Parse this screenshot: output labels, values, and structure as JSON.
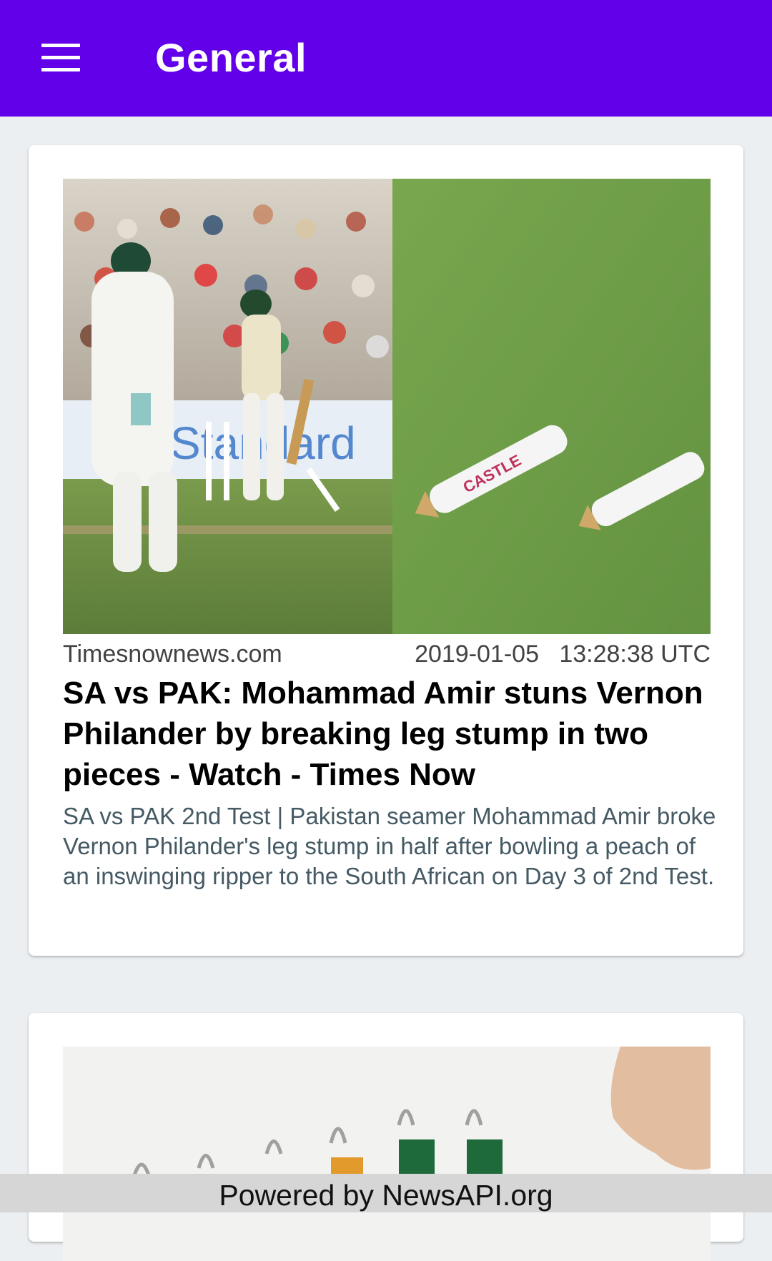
{
  "appbar": {
    "title": "General",
    "menu_icon": "menu-icon"
  },
  "articles": [
    {
      "source": "Timesnownews.com",
      "date": "2019-01-05",
      "time": "13:28:38 UTC",
      "title": "SA vs PAK: Mohammad Amir stuns Vernon Philander by breaking leg stump in two pieces - Watch - Times Now",
      "description": "SA vs PAK 2nd Test | Pakistan seamer Mohammad Amir broke Vernon Philander's leg stump in half after bowling a peach of an inswinging ripper to the South African on Day 3 of 2nd Test.",
      "image": "cricket-broken-stump-photo",
      "image_text": {
        "sponsor": "Standard",
        "stump_brand": "CASTLE"
      }
    },
    {
      "image": "binder-clips-photo"
    }
  ],
  "footer": {
    "text": "Powered by NewsAPI.org"
  },
  "colors": {
    "appbar": "#6200ea",
    "background": "#eceff1",
    "card": "#ffffff",
    "footer": "#d6d6d6"
  }
}
